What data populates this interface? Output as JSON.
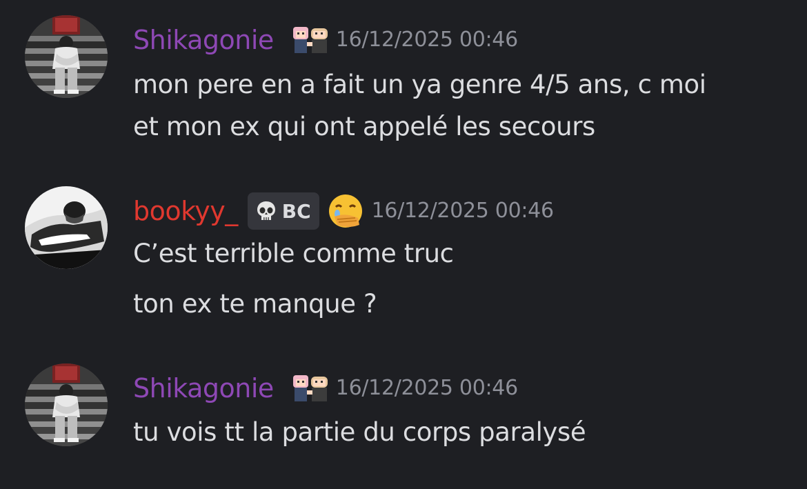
{
  "colors": {
    "background": "#1e1f23",
    "shikagonie_name": "#8e48b5",
    "bookyy_name": "#e0382f",
    "timestamp": "#8e9099",
    "message_text": "#dcdde0",
    "tag_bg": "#35363c"
  },
  "messages": [
    {
      "username": "Shikagonie",
      "role_icon": "pixel-duo-icon",
      "timestamp": "16/12/2025 00:46",
      "lines": [
        "mon pere en a fait un ya genre 4/5 ans, c moi",
        "et mon ex qui ont appelé les secours"
      ]
    },
    {
      "username": "bookyy_",
      "tag_icon": "skull-icon",
      "tag_text": "BC",
      "emoji_icon": "face-with-hand-over-mouth-icon",
      "timestamp": "16/12/2025 00:46",
      "lines": [
        "C’est terrible comme truc",
        "ton ex te manque ?"
      ]
    },
    {
      "username": "Shikagonie",
      "role_icon": "pixel-duo-icon",
      "timestamp": "16/12/2025 00:46",
      "lines": [
        "tu vois tt la partie du corps paralysé"
      ]
    }
  ]
}
